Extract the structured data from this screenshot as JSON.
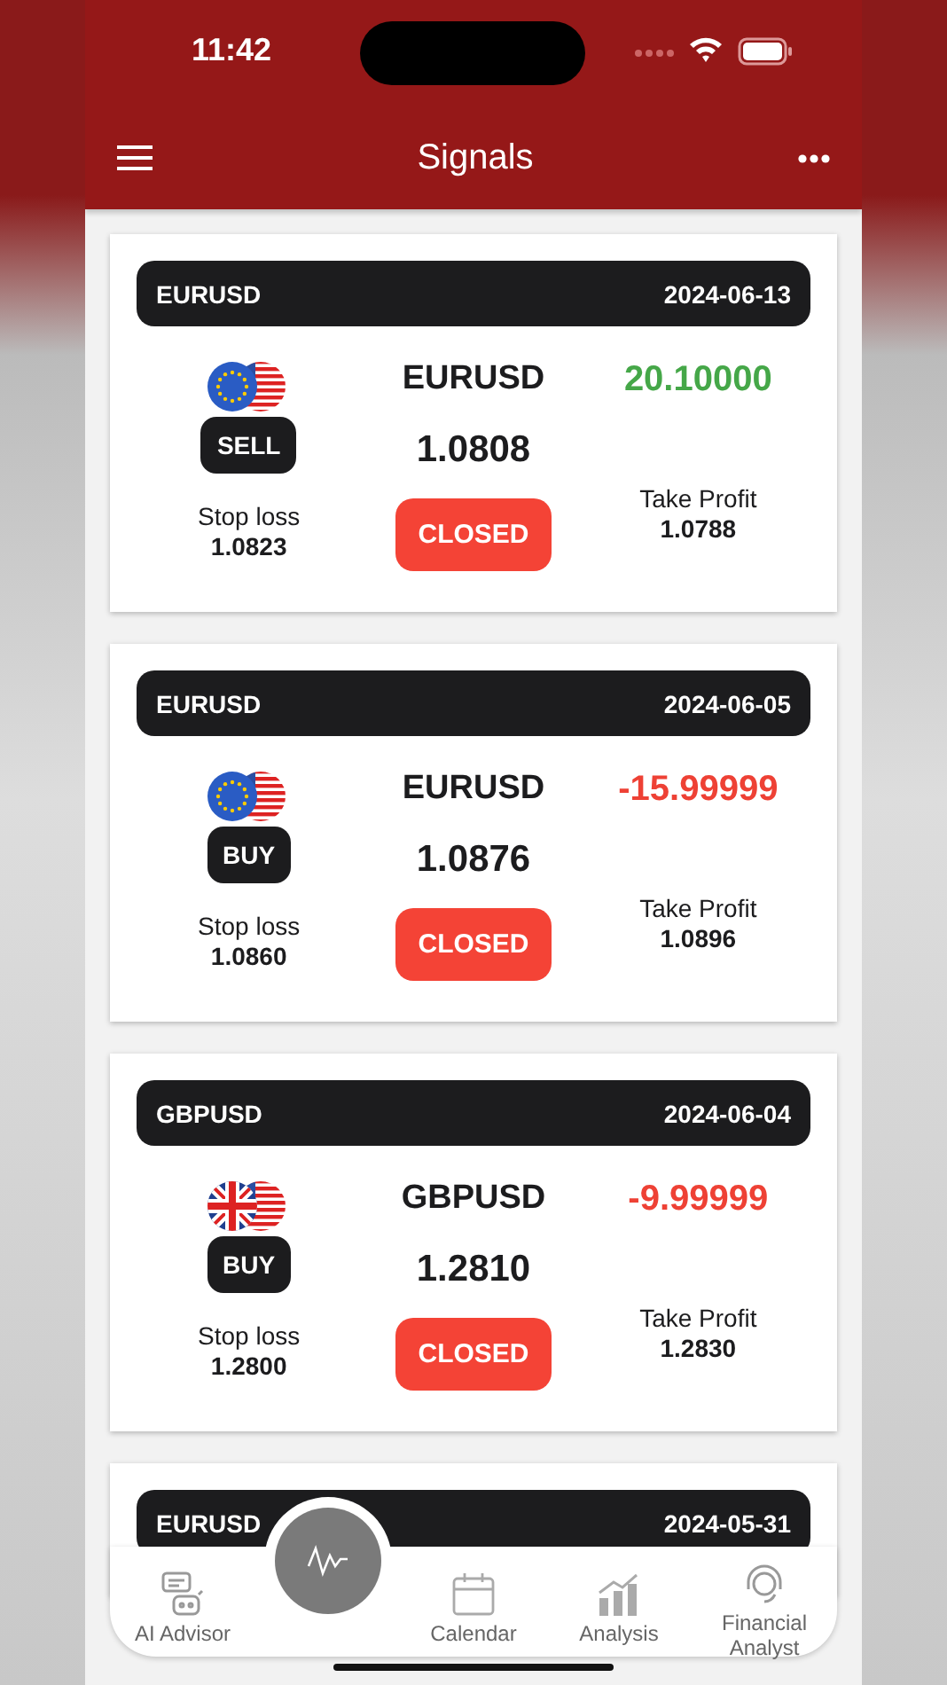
{
  "status_bar": {
    "time": "11:42"
  },
  "app_bar": {
    "title": "Signals"
  },
  "signals": [
    {
      "pair": "EURUSD",
      "date": "2024-06-13",
      "kind": "eu",
      "direction": "SELL",
      "name": "EURUSD",
      "price": "1.0808",
      "result": "20.10000",
      "color": "#45a748",
      "stop_label": "Stop loss",
      "stop_value": "1.0823",
      "status": "CLOSED",
      "take_label": "Take Profit",
      "take_value": "1.0788"
    },
    {
      "pair": "EURUSD",
      "date": "2024-06-05",
      "kind": "eu",
      "direction": "BUY",
      "name": "EURUSD",
      "price": "1.0876",
      "result": "-15.99999",
      "color": "#ee4135",
      "stop_label": "Stop loss",
      "stop_value": "1.0860",
      "status": "CLOSED",
      "take_label": "Take Profit",
      "take_value": "1.0896"
    },
    {
      "pair": "GBPUSD",
      "date": "2024-06-04",
      "kind": "gb",
      "direction": "BUY",
      "name": "GBPUSD",
      "price": "1.2810",
      "result": "-9.99999",
      "color": "#ee4135",
      "stop_label": "Stop loss",
      "stop_value": "1.2800",
      "status": "CLOSED",
      "take_label": "Take Profit",
      "take_value": "1.2830"
    },
    {
      "pair": "EURUSD",
      "date": "2024-05-31"
    }
  ],
  "bottom_nav": [
    {
      "kind": "advisor",
      "label": "AI Advisor"
    },
    {
      "kind": "center"
    },
    {
      "kind": "calendar",
      "label": "Calendar"
    },
    {
      "kind": "analysis",
      "label": "Analysis"
    },
    {
      "kind": "analyst",
      "label": "Financial Analyst"
    }
  ]
}
